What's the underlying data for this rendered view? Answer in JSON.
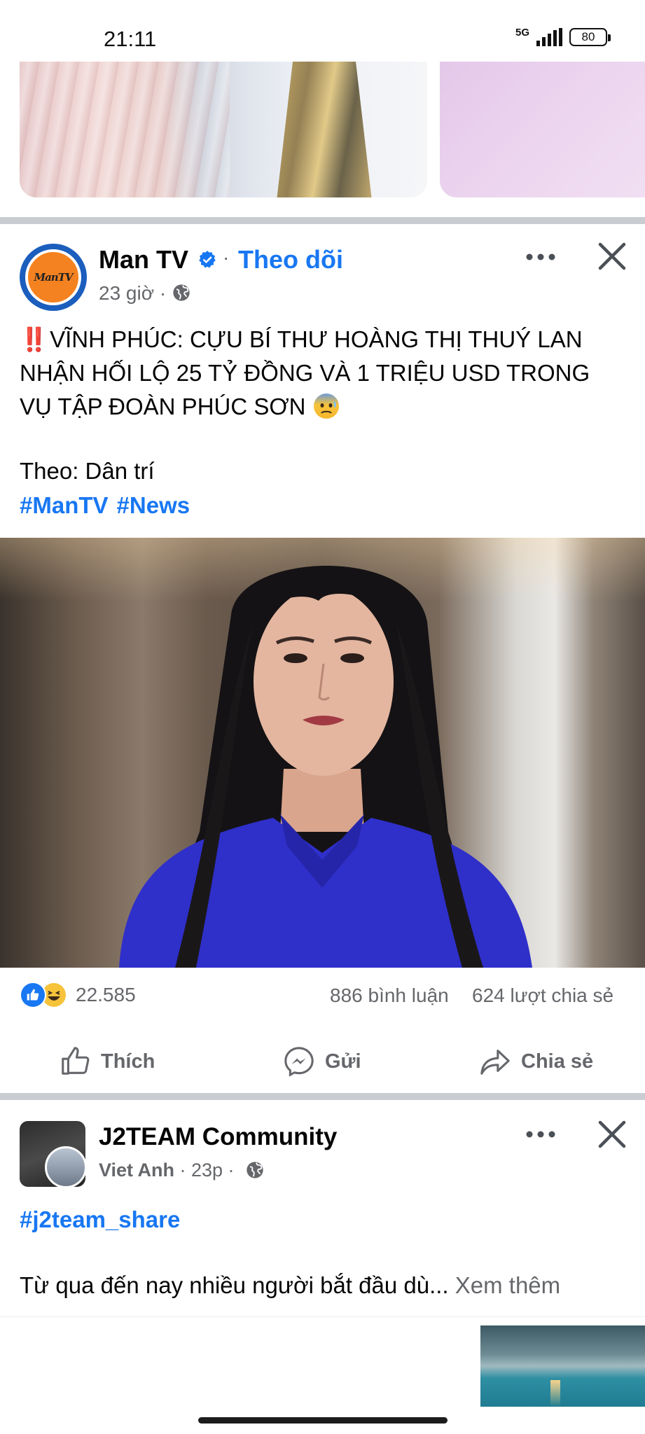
{
  "status_bar": {
    "time": "21:11",
    "network": "5G",
    "battery": "80"
  },
  "post1": {
    "avatar_text": "ManTV",
    "page_name": "Man TV",
    "separator": "·",
    "follow_label": "Theo dõi",
    "time": "23 giờ ·",
    "text_lines": [
      "VĨNH PHÚC: CỰU BÍ THƯ HOÀNG THỊ THUÝ LAN",
      "NHẬN HỐI LỘ 25 TỶ ĐỒNG VÀ 1 TRIỆU USD TRONG",
      "VỤ TẬP ĐOÀN PHÚC SƠN"
    ],
    "prefix_emoji": "‼️",
    "source_line": "Theo: Dân trí",
    "hashtags": [
      "#ManTV",
      "#News"
    ],
    "reaction_count": "22.585",
    "comment_count": "886 bình luận",
    "share_count": "624 lượt chia sẻ",
    "actions": {
      "like": "Thích",
      "send": "Gửi",
      "share": "Chia sẻ"
    }
  },
  "post2": {
    "page_name": "J2TEAM Community",
    "author": "Viet Anh",
    "time": " · 23p ·",
    "hashtag": "#j2team_share",
    "text": "Từ qua đến nay nhiều người bắt đầu dù...",
    "see_more": " Xem thêm"
  },
  "colors": {
    "accent": "#1877f2",
    "secondary_text": "#65676b",
    "divider": "#c9ccd1",
    "mantv_orange": "#f58220"
  },
  "icons": [
    "verified-badge-icon",
    "globe-icon",
    "more-horizontal-icon",
    "close-icon",
    "like-reaction-icon",
    "haha-reaction-icon",
    "thumbs-up-icon",
    "messenger-icon",
    "share-arrow-icon"
  ]
}
